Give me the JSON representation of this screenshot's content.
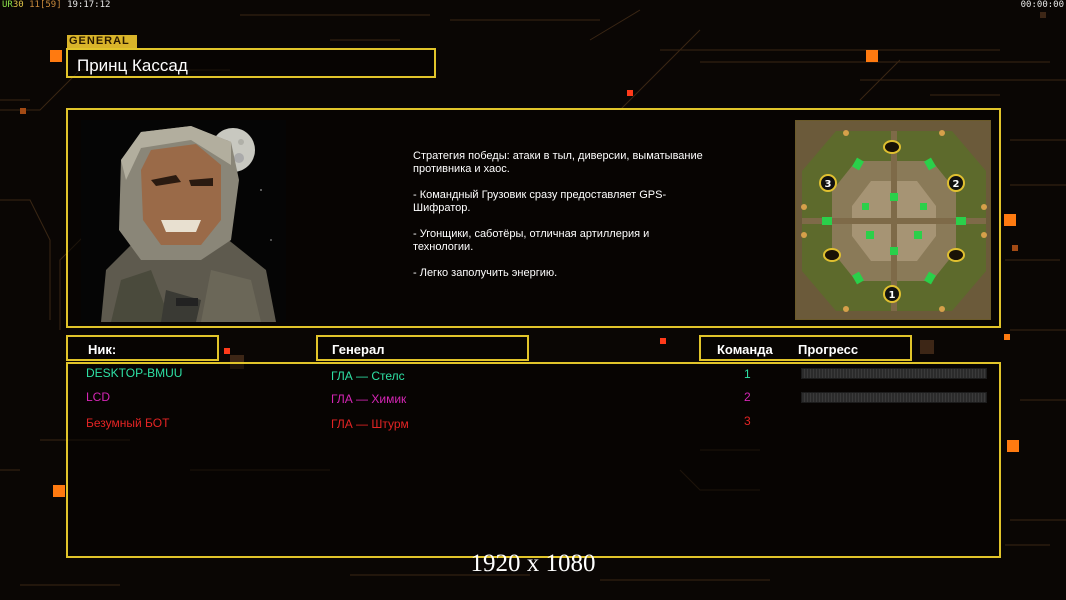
{
  "hud": {
    "ver_label": "UR",
    "ver_value": "30",
    "frame_a": "11",
    "frame_b": "[59]",
    "clock": "19:17:12",
    "timer": "00:00:00"
  },
  "general": {
    "tag": "GENERAL",
    "name": "Принц Кассад",
    "description": [
      "Стратегия победы: атаки в тыл, диверсии, выматывание противника и хаос.",
      "- Командный Грузовик сразу предоставляет GPS-Шифратор.",
      "- Угонщики, саботёры, отличная артиллерия и технологии.",
      "- Легко заполучить энергию."
    ]
  },
  "table": {
    "headers": {
      "nick": "Ник:",
      "general": "Генерал",
      "team": "Команда",
      "progress": "Прогресс"
    },
    "players": [
      {
        "nick": "DESKTOP-BMUU",
        "general": "ГЛА — Стелс",
        "team": "1",
        "color": "#2ee0a4",
        "has_progress": true
      },
      {
        "nick": "LCD",
        "general": "ГЛА — Химик",
        "team": "2",
        "color": "#d526b5",
        "has_progress": true
      },
      {
        "nick": "Безумный БОТ",
        "general": "ГЛА — Штурм",
        "team": "3",
        "color": "#e42424",
        "has_progress": false
      }
    ]
  },
  "map": {
    "start_positions": [
      "1",
      "2",
      "3"
    ]
  },
  "resolution": "1920 x 1080",
  "colors": {
    "frame": "#e1c42a",
    "accent": "#ff7a10",
    "background": "#0a0604"
  }
}
